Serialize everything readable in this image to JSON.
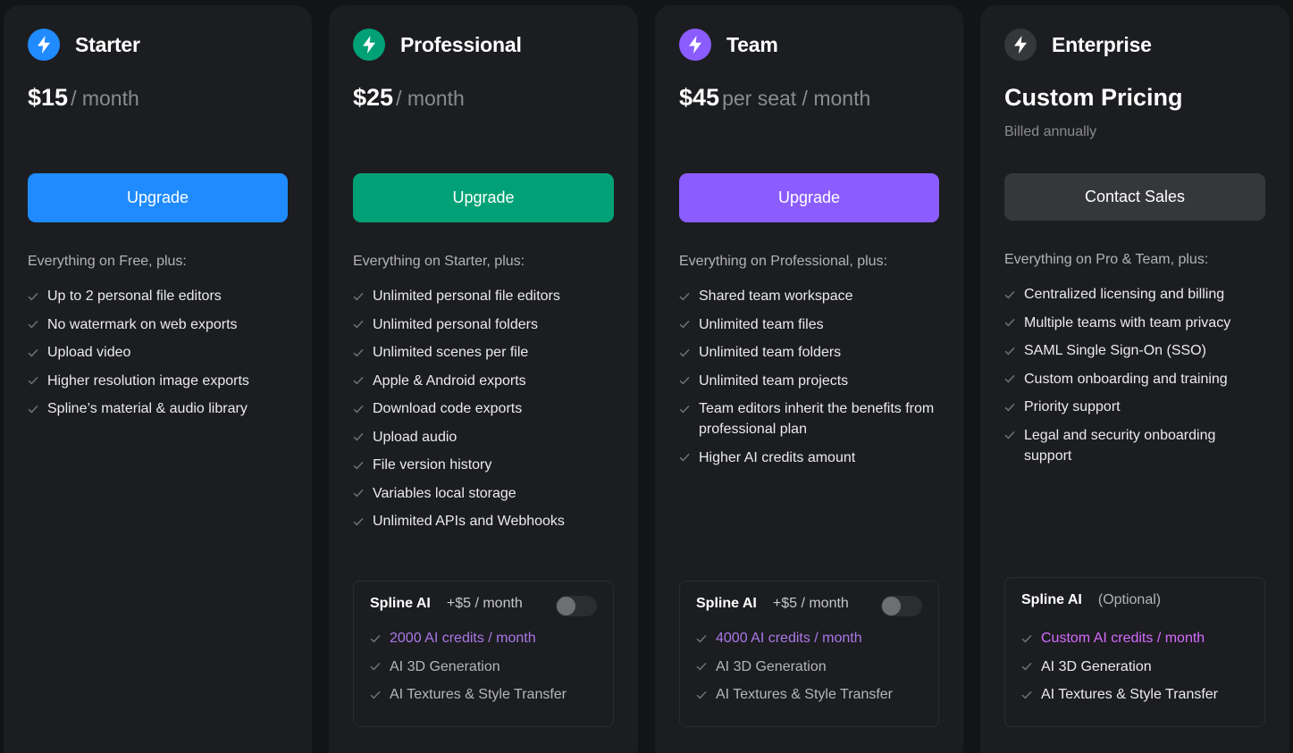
{
  "colors": {
    "starter_accent": "#1f8bff",
    "professional_accent": "#00a176",
    "team_accent": "#8b5cff",
    "enterprise_icon_bg": "#36373b",
    "contact_sales_bg": "#36373b",
    "check_mark": "#6f7075",
    "credits_text": "#a978e8",
    "custom_credits_text": "#d46bff"
  },
  "plans": [
    {
      "icon": "lightning-bolt-icon",
      "name": "Starter",
      "price": "$15",
      "unit": "/ month",
      "cta": "Upgrade",
      "intro": "Everything on Free, plus:",
      "features": [
        "Up to 2 personal file editors",
        "No watermark on web exports",
        "Upload video",
        "Higher resolution image exports",
        "Spline’s material & audio library"
      ]
    },
    {
      "icon": "lightning-bolt-icon",
      "name": "Professional",
      "price": "$25",
      "unit": "/ month",
      "cta": "Upgrade",
      "intro": "Everything on Starter, plus:",
      "features": [
        "Unlimited personal file editors",
        "Unlimited personal folders",
        "Unlimited scenes per file",
        "Apple & Android exports",
        "Download code exports",
        "Upload audio",
        "File version history",
        "Variables local storage",
        "Unlimited APIs and Webhooks"
      ],
      "ai": {
        "title": "Spline AI",
        "price": "+$5 / month",
        "toggle_on": false,
        "items": [
          "2000 AI credits / month",
          "AI 3D Generation",
          "AI Textures & Style Transfer"
        ]
      }
    },
    {
      "icon": "lightning-bolt-icon",
      "name": "Team",
      "price": "$45",
      "unit": "per seat / month",
      "cta": "Upgrade",
      "intro": "Everything on Professional, plus:",
      "features": [
        "Shared team workspace",
        "Unlimited team files",
        "Unlimited team folders",
        "Unlimited team projects",
        "Team editors inherit the benefits from professional plan",
        "Higher AI credits amount"
      ],
      "ai": {
        "title": "Spline AI",
        "price": "+$5 / month",
        "toggle_on": false,
        "items": [
          "4000 AI credits / month",
          "AI 3D Generation",
          "AI Textures & Style Transfer"
        ]
      }
    },
    {
      "icon": "lightning-bolt-icon",
      "name": "Enterprise",
      "custom_price": "Custom Pricing",
      "billed": "Billed annually",
      "cta": "Contact Sales",
      "intro": "Everything on Pro & Team, plus:",
      "features": [
        "Centralized licensing and billing",
        "Multiple teams with team privacy",
        "SAML Single Sign-On (SSO)",
        "Custom onboarding and training",
        "Priority support",
        "Legal and security onboarding support"
      ],
      "ai": {
        "title": "Spline AI",
        "optional": "(Optional)",
        "items": [
          "Custom AI credits / month",
          "AI 3D Generation",
          "AI Textures & Style Transfer"
        ]
      }
    }
  ]
}
